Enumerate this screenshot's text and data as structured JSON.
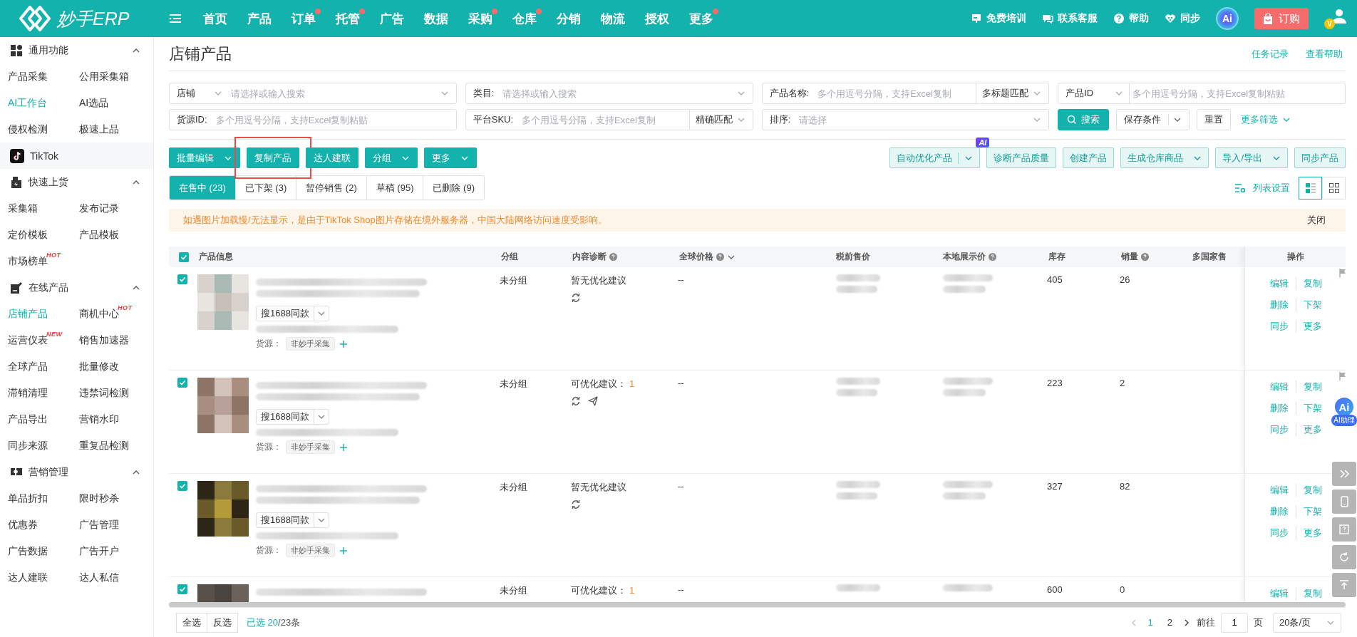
{
  "header": {
    "logo": "妙手ERP",
    "nav": [
      {
        "label": "首页",
        "dot": false
      },
      {
        "label": "产品",
        "dot": false
      },
      {
        "label": "订单",
        "dot": true
      },
      {
        "label": "托管",
        "dot": true
      },
      {
        "label": "广告",
        "dot": false
      },
      {
        "label": "数据",
        "dot": false
      },
      {
        "label": "采购",
        "dot": true
      },
      {
        "label": "仓库",
        "dot": true
      },
      {
        "label": "分销",
        "dot": false
      },
      {
        "label": "物流",
        "dot": false
      },
      {
        "label": "授权",
        "dot": false
      },
      {
        "label": "更多",
        "dot": true
      }
    ],
    "links": [
      {
        "label": "免费培训",
        "kind": "training"
      },
      {
        "label": "联系客服",
        "kind": "service"
      },
      {
        "label": "帮助",
        "kind": "help"
      },
      {
        "label": "同步",
        "kind": "sync"
      }
    ],
    "ai_label": "Ai",
    "order_button": "订购",
    "avatar_badge": "V"
  },
  "sidebar": {
    "sections": [
      {
        "title": "通用功能",
        "kind": "group",
        "expanded": true,
        "items": [
          {
            "label": "产品采集",
            "selected": false
          },
          {
            "label": "公用采集箱",
            "selected": false
          },
          {
            "label": "AI工作台",
            "selected": false,
            "accent": true
          },
          {
            "label": "AI选品",
            "selected": false
          },
          {
            "label": "侵权检测",
            "selected": false
          },
          {
            "label": "极速上品",
            "selected": false
          }
        ]
      },
      {
        "title": "TikTok",
        "kind": "platform"
      },
      {
        "title": "快速上货",
        "kind": "group",
        "expanded": true,
        "items": [
          {
            "label": "采集箱",
            "selected": false
          },
          {
            "label": "发布记录",
            "selected": false
          },
          {
            "label": "定价模板",
            "selected": false
          },
          {
            "label": "产品模板",
            "selected": false
          },
          {
            "label": "市场榜单",
            "selected": false,
            "badge": "HOT"
          }
        ]
      },
      {
        "title": "在线产品",
        "kind": "group",
        "expanded": true,
        "items": [
          {
            "label": "店铺产品",
            "selected": true
          },
          {
            "label": "商机中心",
            "selected": false,
            "badge": "HOT"
          },
          {
            "label": "运营仪表",
            "selected": false,
            "badge": "NEW"
          },
          {
            "label": "销售加速器",
            "selected": false
          },
          {
            "label": "全球产品",
            "selected": false
          },
          {
            "label": "批量修改",
            "selected": false
          },
          {
            "label": "滞销清理",
            "selected": false
          },
          {
            "label": "违禁词检测",
            "selected": false
          },
          {
            "label": "产品导出",
            "selected": false
          },
          {
            "label": "营销水印",
            "selected": false
          },
          {
            "label": "同步来源",
            "selected": false
          },
          {
            "label": "重复品检测",
            "selected": false
          }
        ]
      },
      {
        "title": "营销管理",
        "kind": "group",
        "expanded": true,
        "items": [
          {
            "label": "单品折扣",
            "selected": false
          },
          {
            "label": "限时秒杀",
            "selected": false
          },
          {
            "label": "优惠券",
            "selected": false
          },
          {
            "label": "广告管理",
            "selected": false
          },
          {
            "label": "广告数据",
            "selected": false
          },
          {
            "label": "广告开户",
            "selected": false
          },
          {
            "label": "达人建联",
            "selected": false
          },
          {
            "label": "达人私信",
            "selected": false
          }
        ]
      }
    ]
  },
  "page": {
    "title": "店铺产品",
    "links": [
      "任务记录",
      "查看帮助"
    ]
  },
  "filters": [
    {
      "kind": "select-search",
      "label": "店铺",
      "placeholder": "请选择或输入搜索"
    },
    {
      "kind": "labeled-select",
      "label": "类目:",
      "placeholder": "请选择或输入搜索"
    },
    {
      "kind": "labeled-match",
      "label": "产品名称:",
      "placeholder": "多个用逗号分隔，支持Excel复制",
      "match": "多标题匹配"
    },
    {
      "kind": "select-input",
      "label": "产品ID",
      "placeholder": "多个用逗号分隔，支持Excel复制粘贴"
    },
    {
      "kind": "labeled",
      "label": "货源ID:",
      "placeholder": "多个用逗号分隔，支持Excel复制粘贴"
    },
    {
      "kind": "labeled-match",
      "label": "平台SKU:",
      "placeholder": "多个用逗号分隔，支持Excel复制",
      "match": "精确匹配"
    },
    {
      "kind": "labeled-select",
      "label": "排序:",
      "placeholder": "请选择"
    }
  ],
  "filter_buttons": [
    {
      "label": "搜索",
      "kind": "primary"
    },
    {
      "label": "保存条件",
      "kind": "split"
    },
    {
      "label": "重置",
      "kind": "plain"
    },
    {
      "label": "更多筛选",
      "kind": "link"
    }
  ],
  "actions_left": [
    {
      "label": "批量编辑",
      "kind": "dropdown"
    },
    {
      "label": "复制产品",
      "kind": "plain",
      "annotated": true
    },
    {
      "label": "达人建联",
      "kind": "plain"
    },
    {
      "label": "分组",
      "kind": "dropdown"
    },
    {
      "label": "更多",
      "kind": "dropdown"
    }
  ],
  "actions_right": [
    {
      "label": "自动优化产品",
      "kind": "split",
      "badge": "AI"
    },
    {
      "label": "诊断产品质量",
      "kind": "plain"
    },
    {
      "label": "创建产品",
      "kind": "plain"
    },
    {
      "label": "生成仓库商品",
      "kind": "dropdown"
    },
    {
      "label": "导入/导出",
      "kind": "dropdown"
    },
    {
      "label": "同步产品",
      "kind": "plain"
    }
  ],
  "tabs": [
    {
      "label": "在售中 (23)",
      "selected": true
    },
    {
      "label": "已下架 (3)",
      "selected": false
    },
    {
      "label": "暂停销售 (2)",
      "selected": false
    },
    {
      "label": "草稿 (95)",
      "selected": false
    },
    {
      "label": "已删除 (9)",
      "selected": false
    }
  ],
  "list_settings": "列表设置",
  "views": [
    {
      "kind": "list",
      "selected": true
    },
    {
      "kind": "grid",
      "selected": false
    }
  ],
  "notice": {
    "text": "如遇图片加载慢/无法显示，是由于TikTok Shop图片存储在境外服务器，中国大陆网络访问速度受影响。",
    "close": "关闭"
  },
  "table": {
    "all_checked": true,
    "columns": [
      {
        "label": "产品信息"
      },
      {
        "label": "分组"
      },
      {
        "label": "内容诊断",
        "help": true
      },
      {
        "label": "全球价格",
        "help": true,
        "sortable": true
      },
      {
        "label": "税前售价"
      },
      {
        "label": "本地展示价",
        "help": true
      },
      {
        "label": "库存"
      },
      {
        "label": "销量",
        "help": true
      },
      {
        "label": "多国家售"
      },
      {
        "label": "操作"
      }
    ],
    "rows": [
      {
        "checked": true,
        "image": {
          "kind": "picture"
        },
        "search_button": "搜1688同款",
        "source_label": "货源：",
        "source_tag": "非妙手采集",
        "group": "未分组",
        "diagnosis": "暂无优化建议",
        "refresh": true,
        "global_price": "--",
        "stock": "405",
        "sales": "26",
        "actions": [
          "编辑",
          "复制",
          "删除",
          "下架",
          "同步",
          "更多"
        ],
        "flag": true
      },
      {
        "checked": true,
        "image": {
          "kind": "picture"
        },
        "search_button": "搜1688同款",
        "source_label": "货源：",
        "source_tag": "非妙手采集",
        "group": "未分组",
        "diagnosis": "可优化建议：",
        "diagnosis_count": "1",
        "refresh": true,
        "send": true,
        "global_price": "--",
        "stock": "223",
        "sales": "2",
        "actions": [
          "编辑",
          "复制",
          "删除",
          "下架",
          "同步",
          "更多"
        ],
        "flag": true
      },
      {
        "checked": true,
        "image": {
          "kind": "picture"
        },
        "search_button": "搜1688同款",
        "source_label": "货源：",
        "source_tag": "非妙手采集",
        "group": "未分组",
        "diagnosis": "暂无优化建议",
        "refresh": true,
        "global_price": "--",
        "stock": "327",
        "sales": "82",
        "actions": [
          "编辑",
          "复制",
          "删除",
          "下架",
          "同步",
          "更多"
        ]
      },
      {
        "checked": true,
        "image": {
          "kind": "picture"
        },
        "group": "未分组",
        "diagnosis": "可优化建议：",
        "diagnosis_count": "1",
        "global_price": "--",
        "stock": "600",
        "sales": "0",
        "actions": [
          "编辑",
          "复制"
        ]
      }
    ]
  },
  "footer": {
    "select_all": "全选",
    "invert": "反选",
    "selected_count": "已选 20",
    "total": "/23条",
    "pages": [
      {
        "label": "1",
        "selected": true
      },
      {
        "label": "2",
        "selected": false
      }
    ],
    "goto_label": "前往",
    "goto_value": "1",
    "page_unit": "页",
    "page_size": "20条/页"
  },
  "assistant": {
    "icon_text": "Ai",
    "label": "AI助理"
  }
}
